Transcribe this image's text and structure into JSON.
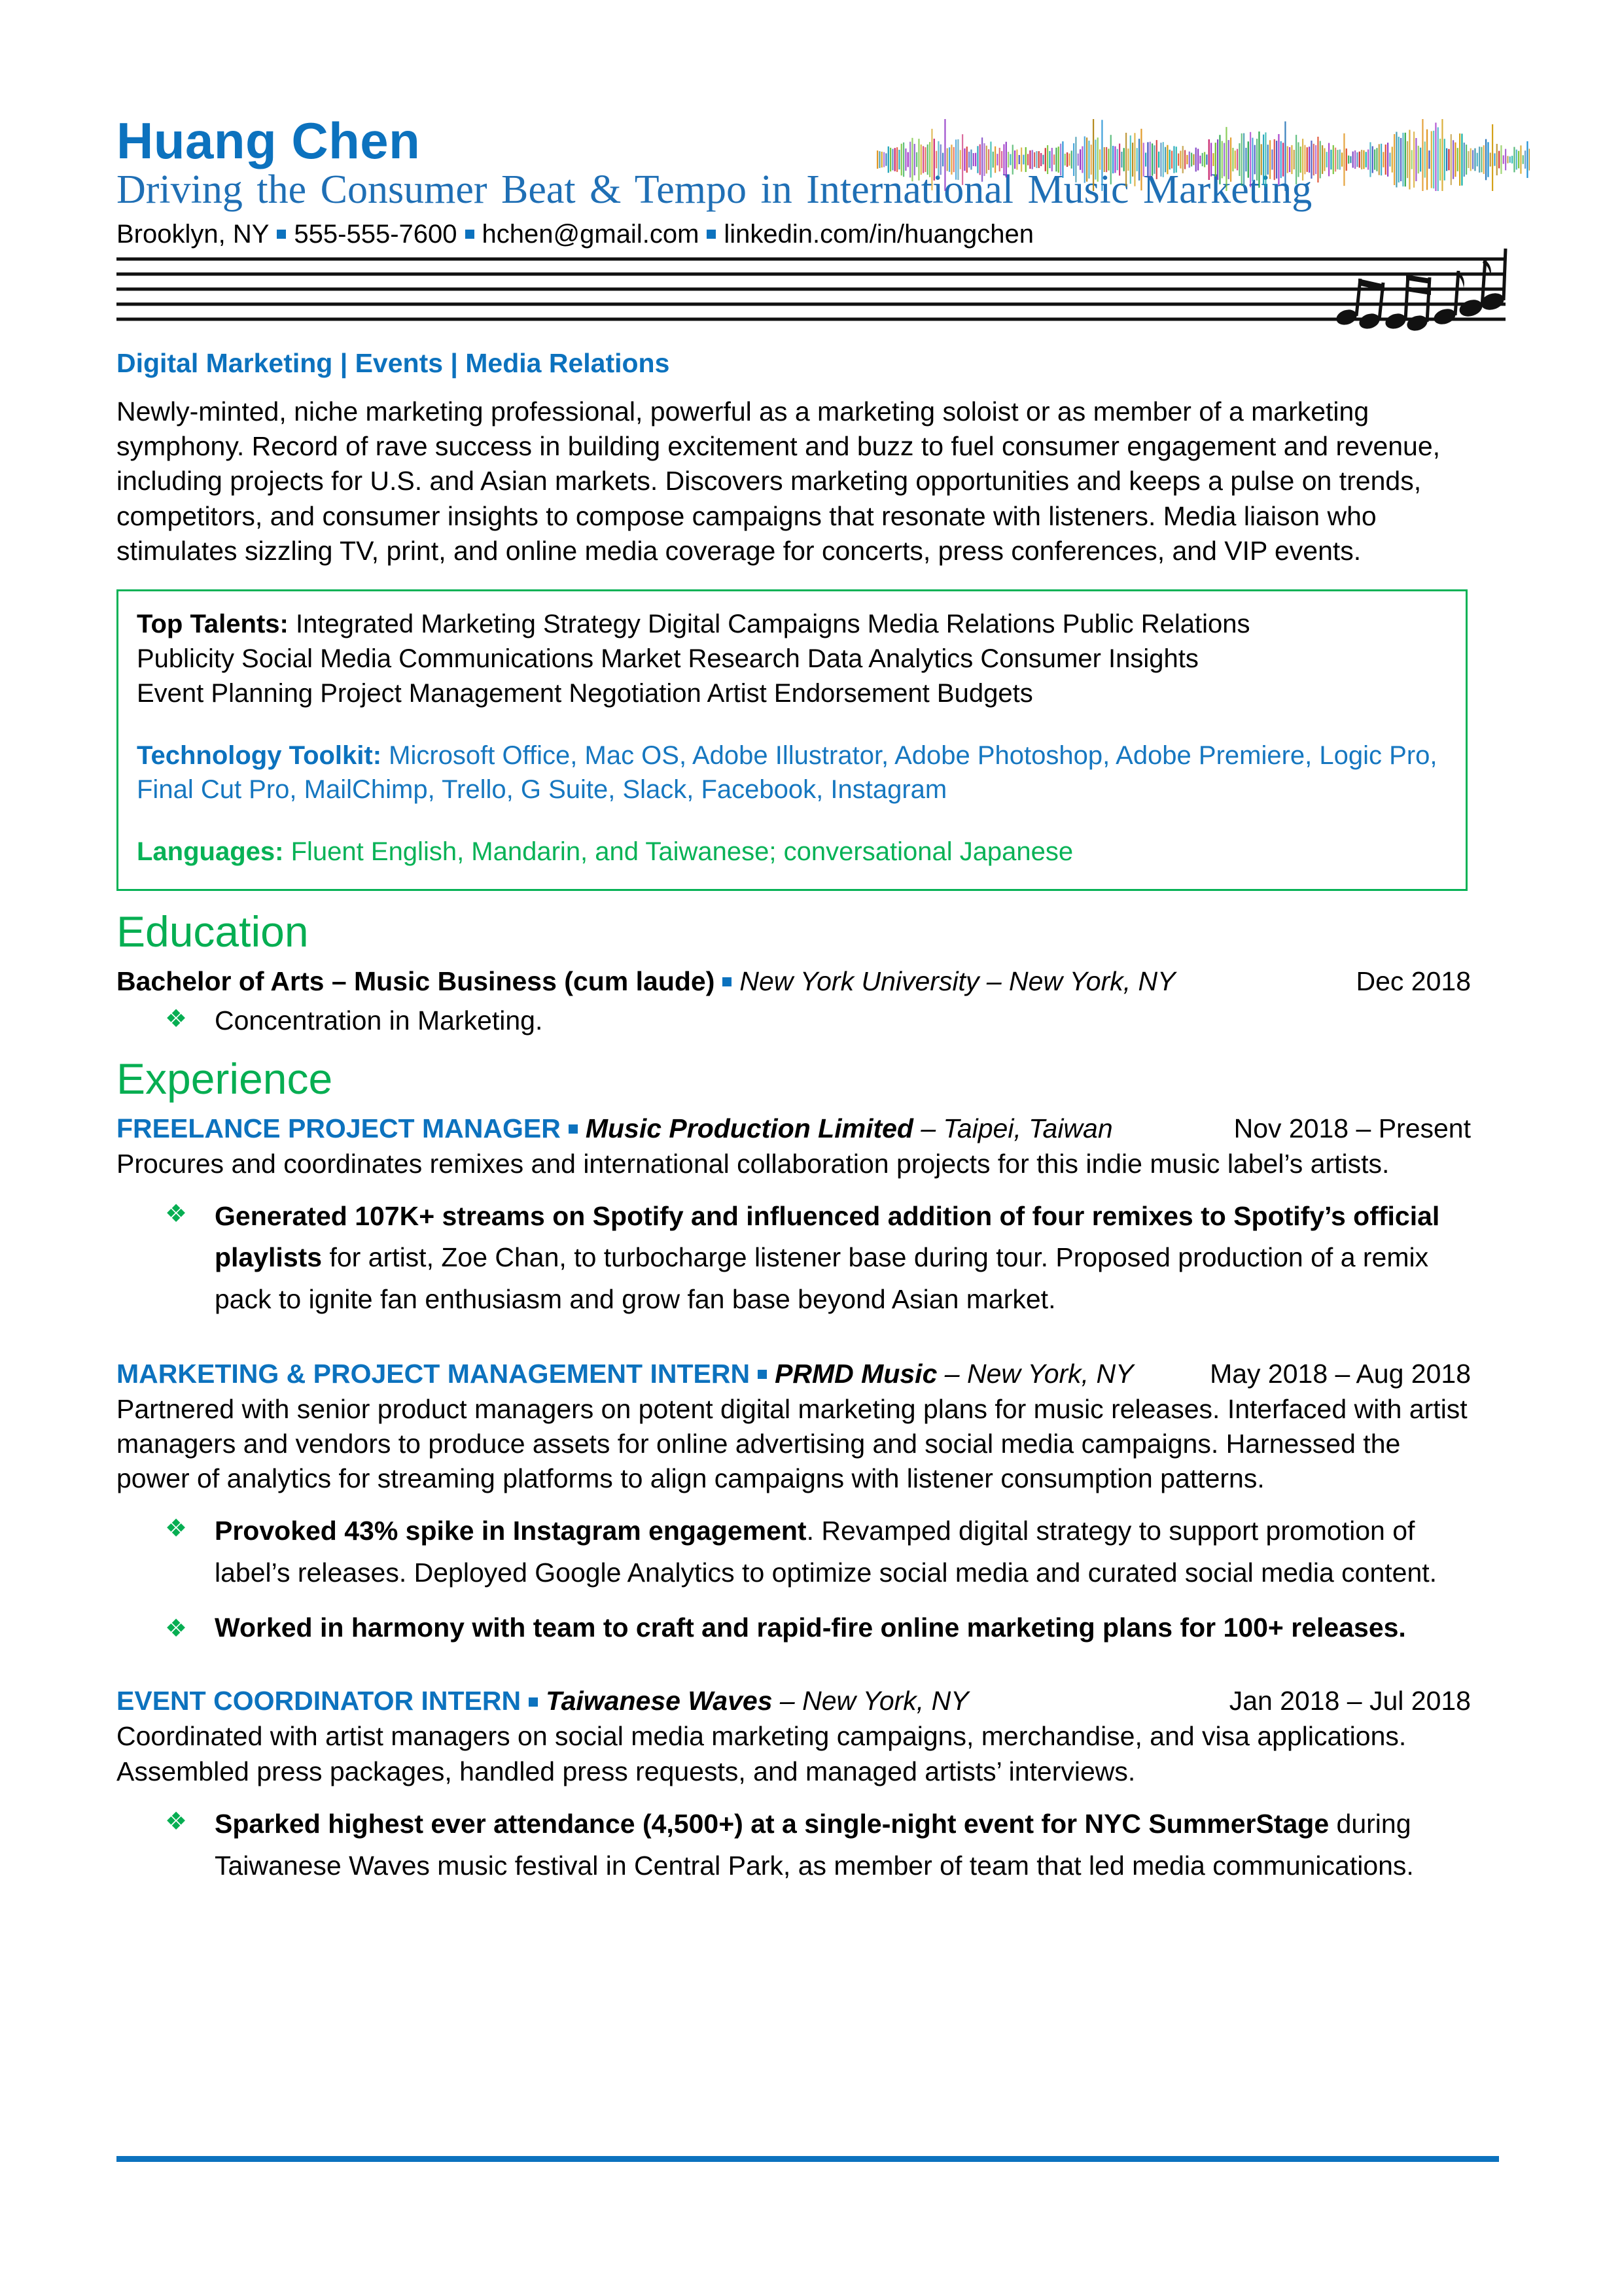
{
  "header": {
    "name": "Huang Chen",
    "tagline": "Driving the Consumer Beat & Tempo in International Music Marketing",
    "contact": {
      "location": "Brooklyn, NY",
      "phone": "555-555-7600",
      "email": "hchen@gmail.com",
      "linkedin": "linkedin.com/in/huangchen"
    },
    "waveform_icon": "audio-waveform-icon",
    "staff_icon": "music-staff-icon"
  },
  "headline": "Digital Marketing | Events | Media Relations",
  "summary": "Newly-minted, niche marketing professional, powerful as a marketing soloist or as member of a marketing symphony. Record of rave success in building excitement and buzz to fuel consumer engagement and revenue, including projects for U.S. and Asian markets. Discovers marketing opportunities and keeps a pulse on trends, competitors, and consumer insights to compose campaigns that resonate with listeners. Media liaison who stimulates sizzling TV, print, and online media coverage for concerts, press conferences, and VIP events.",
  "skills_box": {
    "top_talents_label": "Top Talents:",
    "top_talents_line1": " Integrated Marketing Strategy  Digital Campaigns  Media Relations  Public Relations",
    "top_talents_line2": "Publicity  Social Media  Communications  Market Research  Data Analytics  Consumer Insights",
    "top_talents_line3": "Event Planning  Project Management  Negotiation  Artist Endorsement  Budgets",
    "technology_label": "Technology Toolkit:",
    "technology_value": " Microsoft Office, Mac OS, Adobe Illustrator, Adobe Photoshop, Adobe Premiere, Logic Pro, Final Cut Pro, MailChimp, Trello, G Suite, Slack, Facebook, Instagram",
    "languages_label": "Languages:",
    "languages_value": " Fluent English, Mandarin, and Taiwanese; conversational Japanese"
  },
  "education": {
    "heading": "Education",
    "degree": "Bachelor of Arts – Music Business (cum laude)",
    "school": "New York University",
    "location": " – New York, NY",
    "date": "Dec 2018",
    "bullet": "Concentration in Marketing."
  },
  "experience": {
    "heading": "Experience",
    "jobs": [
      {
        "title": "FREELANCE PROJECT MANAGER",
        "company": "Music Production Limited",
        "location": " – Taipei, Taiwan",
        "date": "Nov 2018 – Present",
        "description": "Procures and coordinates remixes and international collaboration projects for this indie music label’s artists.",
        "bullets": [
          {
            "bold": "Generated 107K+ streams on Spotify and influenced addition of four remixes to Spotify’s official playlists",
            "rest": " for artist, Zoe Chan, to turbocharge listener base during tour. Proposed production of a remix pack to ignite fan enthusiasm and grow fan base beyond Asian market."
          }
        ]
      },
      {
        "title": "MARKETING & PROJECT MANAGEMENT INTERN",
        "company": "PRMD Music",
        "location": " – New York, NY",
        "date": "May 2018 – Aug 2018",
        "description": "Partnered with senior product managers on potent digital marketing plans for music releases. Interfaced with artist managers and vendors to produce assets for online advertising and social media campaigns. Harnessed the power of analytics for streaming platforms to align campaigns with listener consumption patterns.",
        "bullets": [
          {
            "bold": "Provoked 43% spike in Instagram engagement",
            "rest": ". Revamped digital strategy to support promotion of label’s releases. Deployed Google Analytics to optimize social media and curated social media content."
          },
          {
            "bold": "Worked in harmony with team to craft and rapid-fire online marketing plans for 100+ releases.",
            "rest": ""
          }
        ]
      },
      {
        "title": "EVENT COORDINATOR INTERN",
        "company": "Taiwanese Waves",
        "location": " – New York, NY",
        "date": "Jan 2018 – Jul 2018",
        "description": "Coordinated with artist managers on social media marketing campaigns, merchandise, and visa applications. Assembled press packages, handled press requests, and managed artists’ interviews.",
        "bullets": [
          {
            "bold": "Sparked highest ever attendance (4,500+) at a single-night event for NYC SummerStage",
            "rest": " during Taiwanese Waves music festival in Central Park, as member of team that led media communications."
          }
        ]
      }
    ]
  },
  "bullet_glyph": "❖",
  "colors": {
    "name_blue": "#0C72BE",
    "tagline_blue": "#1F6FB5",
    "heading_green": "#06AE52",
    "box_green": "#07B256",
    "rule_blue": "#0C72BE"
  }
}
